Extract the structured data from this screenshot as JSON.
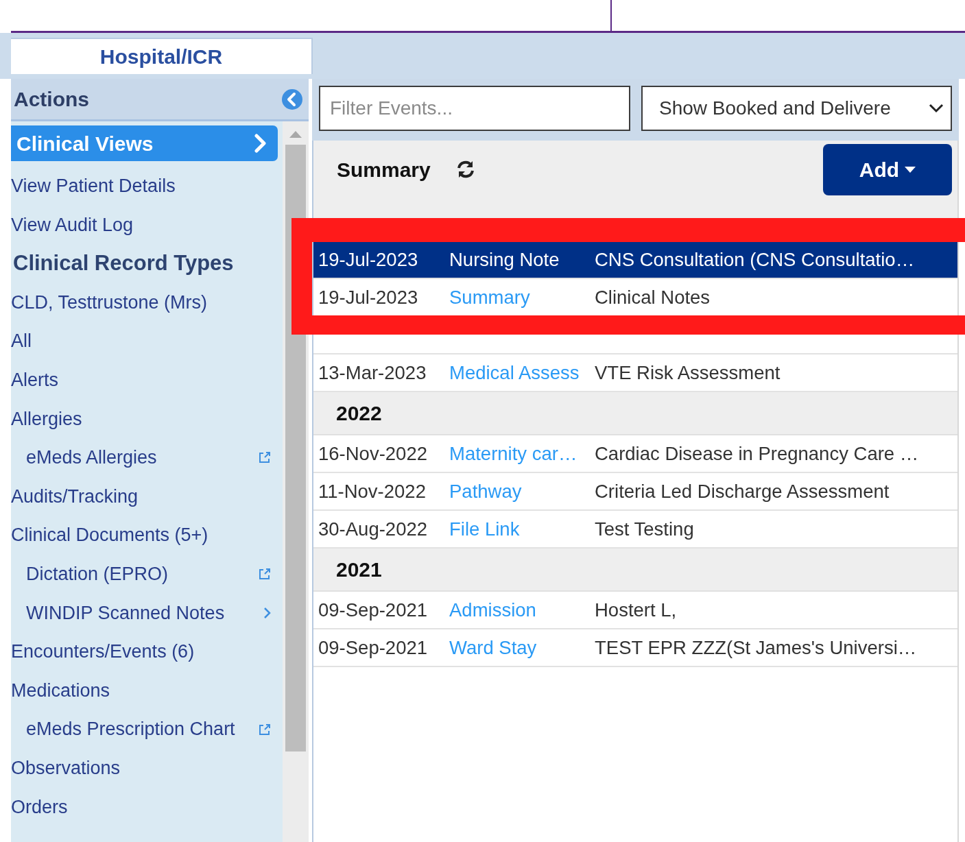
{
  "tabs": [
    {
      "label": "Hospital/ICR",
      "selected": true
    }
  ],
  "actions": {
    "title": "Actions"
  },
  "sidebar": {
    "items": [
      {
        "label": "Clinical Views",
        "kind": "button",
        "selected": true
      },
      {
        "label": "View Patient Details",
        "kind": "link",
        "selected": false
      },
      {
        "label": "View Audit Log",
        "kind": "link",
        "selected": false
      },
      {
        "label": "Clinical Record Types",
        "kind": "heading",
        "selected": false
      },
      {
        "label": "CLD, Testtrustone (Mrs)",
        "kind": "link",
        "selected": false
      },
      {
        "label": "All",
        "kind": "link",
        "selected": false
      },
      {
        "label": "Alerts",
        "kind": "link",
        "selected": false
      },
      {
        "label": "Allergies",
        "kind": "link",
        "selected": false,
        "children": [
          {
            "label": "eMeds Allergies",
            "kind": "external",
            "selected": false
          }
        ]
      },
      {
        "label": "Audits/Tracking",
        "kind": "link",
        "selected": false
      },
      {
        "label": "Clinical Documents (5+)",
        "kind": "link",
        "selected": false,
        "children": [
          {
            "label": "Dictation (EPRO)",
            "kind": "external",
            "selected": false
          },
          {
            "label": "WINDIP Scanned Notes",
            "kind": "submenu",
            "selected": false
          }
        ]
      },
      {
        "label": "Encounters/Events (6)",
        "kind": "link",
        "selected": false
      },
      {
        "label": "Medications",
        "kind": "link",
        "selected": false,
        "children": [
          {
            "label": "eMeds Prescription Chart",
            "kind": "external",
            "selected": false
          }
        ]
      },
      {
        "label": "Observations",
        "kind": "link",
        "selected": false
      },
      {
        "label": "Orders",
        "kind": "link",
        "selected": false
      }
    ]
  },
  "filter": {
    "placeholder": "Filter Events..."
  },
  "view_select": {
    "value": "Show Booked and Delivere"
  },
  "summary": {
    "title": "Summary",
    "add_button": "Add"
  },
  "groups": [
    {
      "rows": [
        {
          "date": "19-Jul-2023",
          "type": "Nursing Note",
          "description": "CNS Consultation (CNS Consultatio…",
          "selected": true
        },
        {
          "date": "19-Jul-2023",
          "type": "Summary",
          "description": "Clinical Notes",
          "selected": false
        },
        {
          "selected": false
        },
        {
          "date": "13-Mar-2023",
          "type": "Medical Assess",
          "description": "VTE Risk Assessment",
          "selected": false
        }
      ]
    },
    {
      "year": "2022",
      "rows": [
        {
          "date": "16-Nov-2022",
          "type": "Maternity car…",
          "description": "Cardiac Disease in Pregnancy Care …",
          "selected": false
        },
        {
          "date": "11-Nov-2022",
          "type": "Pathway",
          "description": "Criteria Led Discharge Assessment",
          "selected": false
        },
        {
          "date": "30-Aug-2022",
          "type": "File Link",
          "description": "Test Testing",
          "selected": false
        }
      ]
    },
    {
      "year": "2021",
      "rows": [
        {
          "date": "09-Sep-2021",
          "type": "Admission",
          "description": "Hostert L,",
          "selected": false
        },
        {
          "date": "09-Sep-2021",
          "type": "Ward Stay",
          "description": "TEST EPR ZZZ(St James's Universi…",
          "selected": false
        }
      ]
    }
  ]
}
